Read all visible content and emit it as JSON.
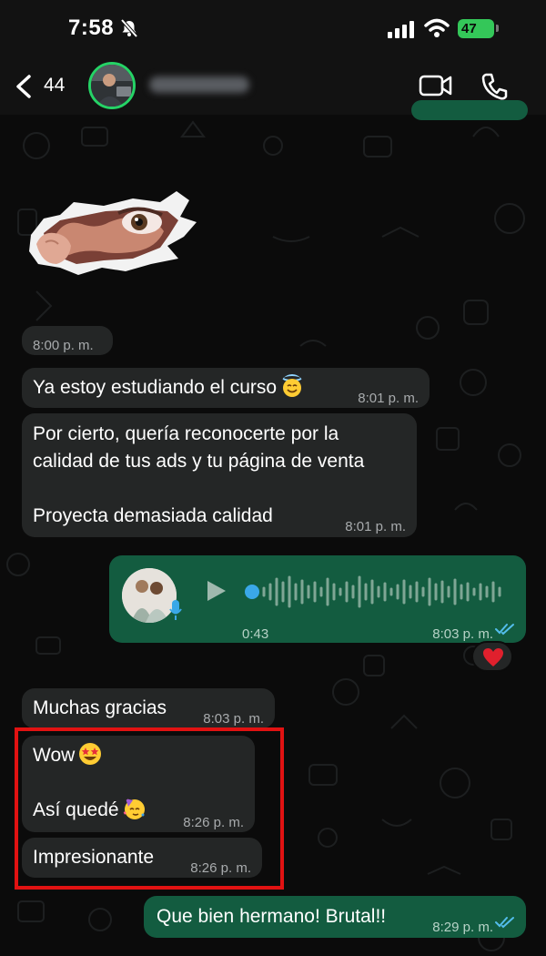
{
  "status_bar": {
    "time": "7:58",
    "battery": "47",
    "silent_icon": "bell-slash-icon",
    "signal_icon": "signal-bars-icon",
    "wifi_icon": "wifi-icon"
  },
  "header": {
    "back_count": "44",
    "back_icon": "chevron-left-icon",
    "video_icon": "video-camera-icon",
    "call_icon": "phone-icon"
  },
  "colors": {
    "incoming_bubble": "#242626",
    "outgoing_bubble": "#135c40",
    "accent_green": "#25d366",
    "read_ticks": "#53bdeb",
    "highlight": "#e11212"
  },
  "messages": [
    {
      "type": "sticker",
      "direction": "in",
      "description_icon": "peeking-eye-sticker"
    },
    {
      "direction": "in",
      "time": "8:00 p. m."
    },
    {
      "direction": "in",
      "text": "Ya estoy estudiando el curso",
      "emoji": "smiling-face-with-halo",
      "time": "8:01 p. m."
    },
    {
      "direction": "in",
      "text": "Por cierto, quería reconocerte por la\ncalidad de tus ads y tu página de venta\n\nProyecta demasiada calidad",
      "time": "8:01 p. m."
    },
    {
      "type": "voice",
      "direction": "out",
      "duration": "0:43",
      "time": "8:03 p. m.",
      "status": "read",
      "reaction": "red-heart"
    },
    {
      "direction": "in",
      "text": "Muchas gracias",
      "time": "8:03 p. m."
    },
    {
      "direction": "in",
      "text": "Wow",
      "emoji": "star-struck",
      "text2": "Así quedé",
      "emoji2": "partying-face",
      "time": "8:26 p. m.",
      "highlighted": true
    },
    {
      "direction": "in",
      "text": "Impresionante",
      "time": "8:26 p. m.",
      "highlighted": true
    },
    {
      "direction": "out",
      "text": "Que bien hermano! Brutal!!",
      "time": "8:29 p. m.",
      "status": "read"
    }
  ]
}
